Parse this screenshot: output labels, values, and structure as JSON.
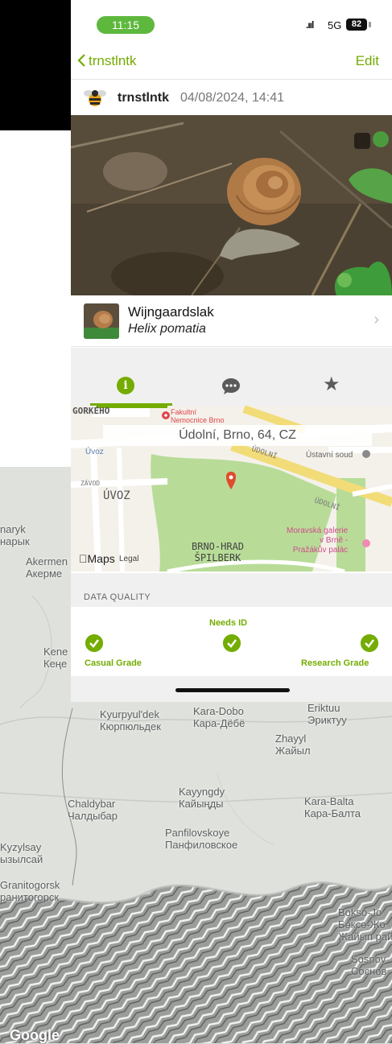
{
  "status_bar": {
    "time": "11:15",
    "signal": ".ııl",
    "network": "5G",
    "battery": "82"
  },
  "nav": {
    "back_label": "trnstlntk",
    "edit_label": "Edit"
  },
  "observation": {
    "user": "trnstlntk",
    "date": "04/08/2024, 14:41"
  },
  "taxon": {
    "common_name": "Wijngaardslak",
    "scientific_name": "Helix pomatia"
  },
  "tabs": [
    {
      "name": "info",
      "icon": "info-icon",
      "active": true
    },
    {
      "name": "comments",
      "icon": "comment-bubble-icon",
      "active": false
    },
    {
      "name": "favorites",
      "icon": "star-icon",
      "active": false
    }
  ],
  "mini_map": {
    "address": "Údolní, Brno, 64, CZ",
    "labels": {
      "gorkeho": "GORKÉHO",
      "hospital_1": "Fakultní",
      "hospital_2": "Nemocnice Brno",
      "uvoz_small": "Úvoz",
      "uvoz": "ÚVOZ",
      "udolni_1": "ÚDOLNÍ",
      "udolni_2": "ÚDOLNÍ",
      "vaclavska": "ZÁVOD",
      "ustavni": "Ústavní soud",
      "brno_hrad_1": "BRNO-HRAD",
      "brno_hrad_2": "ŠPILBERK",
      "moravska_1": "Moravská galerie",
      "moravska_2": "v Brně -",
      "moravska_3": "Pražákův palác",
      "apple_maps": "Maps",
      "legal": "Legal"
    }
  },
  "data_quality": {
    "title": "DATA QUALITY",
    "casual": "Casual Grade",
    "needs_id": "Needs ID",
    "research": "Research Grade"
  },
  "background_map": {
    "labels": {
      "naryk_1": "naryk",
      "naryk_2": "нарык",
      "akermen_1": "Akermen",
      "akermen_2": "Акерме",
      "kene_1": "Kene",
      "kene_2": "Кеңе",
      "kurpyul_1": "Kyurpyul'dek",
      "kurpyul_2": "Кюрпюльдек",
      "karadobo_1": "Kara-Dobo",
      "karadobo_2": "Кара-Дёбё",
      "eriktuu_1": "Eriktuu",
      "eriktuu_2": "Эриктуу",
      "zhayyl_1": "Zhayyl",
      "zhayyl_2": "Жайыл",
      "kayyngdy_1": "Kayyngdy",
      "kayyngdy_2": "Кайыңды",
      "chaldybar_1": "Chaldybar",
      "chaldybar_2": "Чалдыбар",
      "karabalta_1": "Kara-Balta",
      "karabalta_2": "Кара-Балта",
      "panfilov_1": "Panfilovskoye",
      "panfilov_2": "Панфиловское",
      "kyzylsay_1": "Kyzylsay",
      "kyzylsay_2": "ызылсай",
      "granit_1": "Granitogorsk",
      "granit_2": "ранитогорск",
      "bokso_1": "Bokso-Jo",
      "bokso_2": "Бөксө-Жо",
      "bokso_3": "Жайып рай",
      "sosnov_1": "Sosnov",
      "sosnov_2": "Соснов"
    },
    "attribution": "Google"
  }
}
